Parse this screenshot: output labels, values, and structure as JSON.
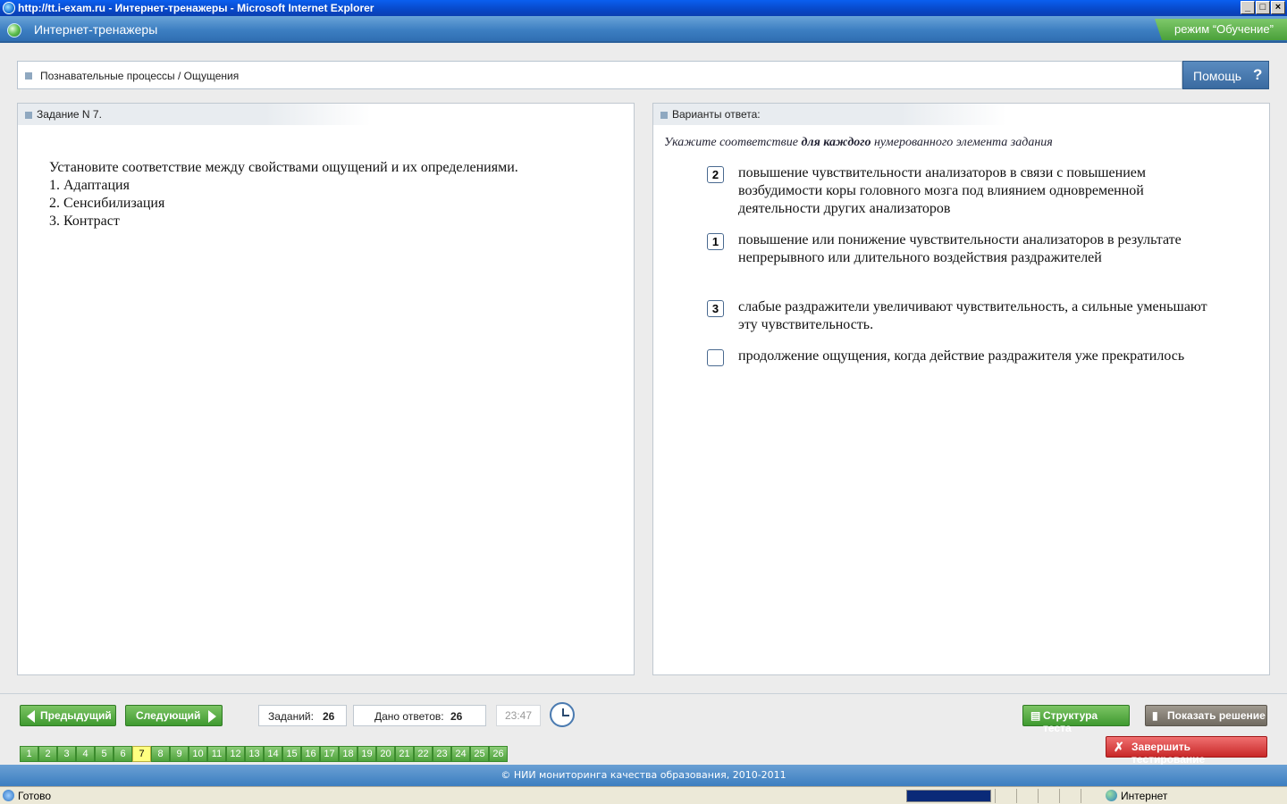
{
  "window": {
    "title": "http://tt.i-exam.ru - Интернет-тренажеры - Microsoft Internet Explorer",
    "buttons": [
      "_",
      "□",
      "×"
    ]
  },
  "app": {
    "title": "Интернет-тренажеры",
    "mode": "режим “Обучение”"
  },
  "breadcrumb": "Познавательные процессы / Ощущения",
  "help_label": "Помощь",
  "help_icon": "?",
  "task": {
    "header": "Задание N 7.",
    "lines": [
      "Установите соответствие между свойствами ощущений и их определениями.",
      "1. Адаптация",
      "2. Сенсибилизация",
      "3. Контраст"
    ]
  },
  "answers": {
    "header": "Варианты ответа:",
    "instruction_pre": "Укажите соответствие ",
    "instruction_bold": "для каждого",
    "instruction_post": " нумерованного элемента задания",
    "items": [
      {
        "value": "2",
        "text": "повышение чувствительности анализаторов в связи с повышением возбудимости коры головного мозга под влиянием одновременной деятельности других анализаторов"
      },
      {
        "value": "1",
        "text": "повышение или понижение чувствительности анализаторов в результате непрерывного или длительного воздействия раздражителей"
      },
      {
        "value": "3",
        "text": "слабые раздражители увеличивают чувствительность, а сильные уменьшают эту чувствительность."
      },
      {
        "value": "",
        "text": "продолжение ощущения, когда действие раздражителя уже прекратилось"
      }
    ]
  },
  "toolbar": {
    "prev_label": "Предыдущий",
    "next_label": "Следующий",
    "tasks_label": "Заданий:",
    "tasks_value": "26",
    "answered_label": "Дано ответов:",
    "answered_value": "26",
    "timer": "23:47",
    "structure_label": "Структура теста",
    "solution_label": "Показать решение",
    "finish_label": "Завершить тестирование"
  },
  "pager": {
    "pages": [
      "1",
      "2",
      "3",
      "4",
      "5",
      "6",
      "7",
      "8",
      "9",
      "10",
      "11",
      "12",
      "13",
      "14",
      "15",
      "16",
      "17",
      "18",
      "19",
      "20",
      "21",
      "22",
      "23",
      "24",
      "25",
      "26"
    ],
    "current": "7"
  },
  "footer": "© НИИ мониторинга качества образования, 2010-2011",
  "statusbar": {
    "status": "Готово",
    "zone": "Интернет",
    "progress": 1.0
  }
}
